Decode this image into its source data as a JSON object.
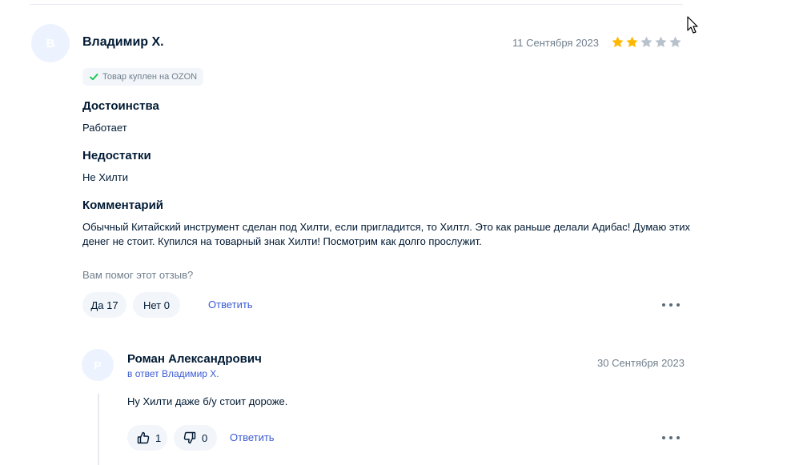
{
  "review": {
    "avatar_letter": "В",
    "author": "Владимир Х.",
    "date": "11 Сентября 2023",
    "rating": 2,
    "rating_max": 5,
    "star_colors": {
      "filled": "#ffb800",
      "empty": "#b8c2cc"
    },
    "purchase_badge": "Товар куплен на OZON",
    "pros_title": "Достоинства",
    "pros_text": "Работает",
    "cons_title": "Недостатки",
    "cons_text": "Не Хилти",
    "comment_title": "Комментарий",
    "comment_text": "Обычный Китайский инструмент сделан под Хилти, если пригладится, то Хилтл. Это как раньше делали Адибас! Думаю этих денег не стоит. Купился на товарный знак Хилти! Посмотрим как долго прослужит.",
    "helpful_question": "Вам помог этот отзыв?",
    "yes_label": "Да 17",
    "no_label": "Нет 0",
    "reply_label": "Ответить",
    "more_icon": "more-dots-icon"
  },
  "reply": {
    "avatar_letter": "Р",
    "author": "Роман Александрович",
    "reply_to": "в ответ Владимир Х.",
    "date": "30 Сентября 2023",
    "text": "Ну Хилти даже б/у стоит дороже.",
    "likes": "1",
    "dislikes": "0",
    "reply_label": "Ответить",
    "more_icon": "more-dots-icon"
  },
  "colors": {
    "accent_link": "#3c5bd5",
    "check_green": "#10c44c",
    "muted_text": "#707f8d"
  }
}
